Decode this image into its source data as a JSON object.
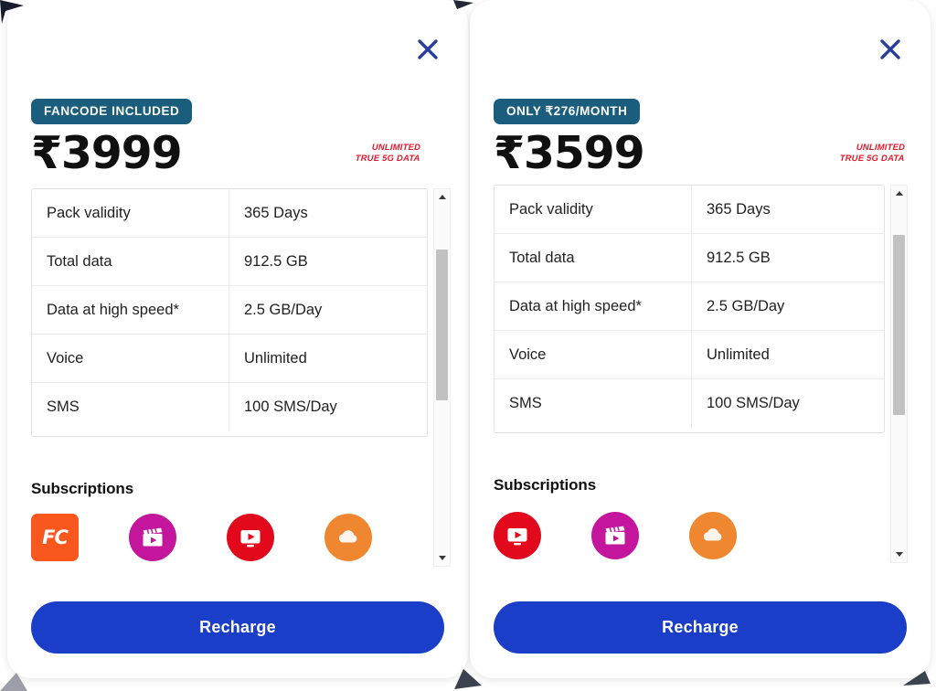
{
  "colors": {
    "badge_bg": "#1b5d7d",
    "price_text": "#101010",
    "fiveg_red": "#e3192b",
    "recharge_blue": "#1a3ec7",
    "close_blue": "#2a3f9d",
    "fancode_orange": "#f9571d",
    "jiocinema_magenta": "#c4169c",
    "jiotv_red": "#e1091b",
    "jiocloud_orange": "#ef8630"
  },
  "spec_labels": {
    "pack_validity": "Pack validity",
    "total_data": "Total data",
    "data_high_speed": "Data at high speed*",
    "voice": "Voice",
    "sms": "SMS"
  },
  "cards": [
    {
      "badge": "FANCODE INCLUDED",
      "price": "₹3999",
      "fiveg_line1": "UNLIMITED",
      "fiveg_line2": "TRUE 5G DATA",
      "close_label": "×",
      "specs": [
        {
          "label": "Pack validity",
          "value": "365 Days"
        },
        {
          "label": "Total data",
          "value": "912.5 GB"
        },
        {
          "label": "Data at high speed*",
          "value": "2.5 GB/Day"
        },
        {
          "label": "Voice",
          "value": "Unlimited"
        },
        {
          "label": "SMS",
          "value": "100 SMS/Day"
        }
      ],
      "subscriptions_title": "Subscriptions",
      "subscriptions": [
        {
          "name": "fancode-icon",
          "label": "FanCode",
          "glyph": "FC",
          "shape": "square",
          "color": "#f9571d"
        },
        {
          "name": "jiocinema-icon",
          "label": "JioCinema",
          "glyph": "clapboard-play",
          "shape": "round",
          "color": "#c4169c"
        },
        {
          "name": "jiotv-icon",
          "label": "JioTV",
          "glyph": "tv-play",
          "shape": "round",
          "color": "#e1091b"
        },
        {
          "name": "jiocloud-icon",
          "label": "JioCloud",
          "glyph": "cloud",
          "shape": "round",
          "color": "#ef8630"
        }
      ],
      "recharge_label": "Recharge",
      "scroll_thumb_top_pct": 16,
      "scroll_thumb_height_pct": 40
    },
    {
      "badge": "ONLY ₹276/MONTH",
      "price": "₹3599",
      "fiveg_line1": "UNLIMITED",
      "fiveg_line2": "TRUE 5G DATA",
      "close_label": "×",
      "specs": [
        {
          "label": "Pack validity",
          "value": "365 Days"
        },
        {
          "label": "Total data",
          "value": "912.5 GB"
        },
        {
          "label": "Data at high speed*",
          "value": "2.5 GB/Day"
        },
        {
          "label": "Voice",
          "value": "Unlimited"
        },
        {
          "label": "SMS",
          "value": "100 SMS/Day"
        }
      ],
      "subscriptions_title": "Subscriptions",
      "subscriptions": [
        {
          "name": "jiotv-icon",
          "label": "JioTV",
          "glyph": "tv-play",
          "shape": "round",
          "color": "#e1091b"
        },
        {
          "name": "jiocinema-icon",
          "label": "JioCinema",
          "glyph": "clapboard-play",
          "shape": "round",
          "color": "#c4169c"
        },
        {
          "name": "jiocloud-icon",
          "label": "JioCloud",
          "glyph": "cloud",
          "shape": "round",
          "color": "#ef8630"
        }
      ],
      "recharge_label": "Recharge",
      "scroll_thumb_top_pct": 13,
      "scroll_thumb_height_pct": 48
    }
  ]
}
